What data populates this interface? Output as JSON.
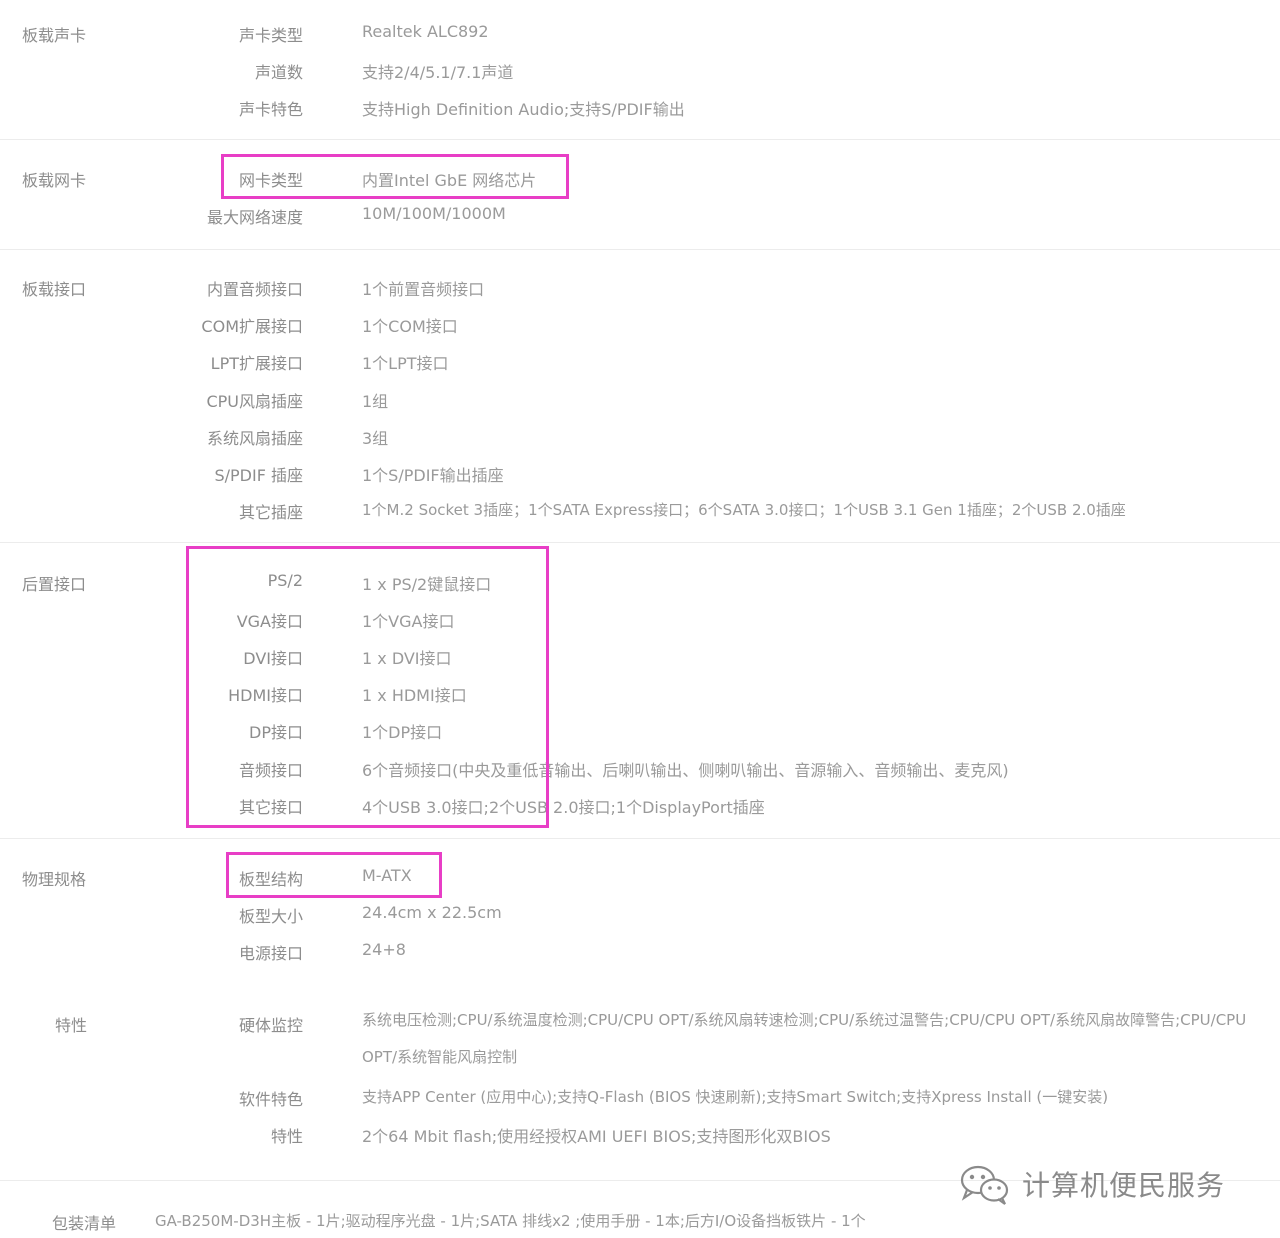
{
  "sections": {
    "audio": {
      "category": "板载声卡",
      "rows": [
        {
          "label": "声卡类型",
          "value": "Realtek ALC892"
        },
        {
          "label": "声道数",
          "value": "支持2/4/5.1/7.1声道"
        },
        {
          "label": "声卡特色",
          "value": "支持High Definition Audio;支持S/PDIF输出"
        }
      ]
    },
    "network": {
      "category": "板载网卡",
      "rows": [
        {
          "label": "网卡类型",
          "value": "内置Intel GbE 网络芯片"
        },
        {
          "label": "最大网络速度",
          "value": "10M/100M/1000M"
        }
      ]
    },
    "board_ports": {
      "category": "板载接口",
      "rows": [
        {
          "label": "内置音频接口",
          "value": "1个前置音频接口"
        },
        {
          "label": "COM扩展接口",
          "value": "1个COM接口"
        },
        {
          "label": "LPT扩展接口",
          "value": "1个LPT接口"
        },
        {
          "label": "CPU风扇插座",
          "value": "1组"
        },
        {
          "label": "系统风扇插座",
          "value": "3组"
        },
        {
          "label": "S/PDIF 插座",
          "value": "1个S/PDIF输出插座"
        },
        {
          "label": "其它插座",
          "value": "1个M.2 Socket 3插座；1个SATA Express接口；6个SATA 3.0接口；1个USB 3.1 Gen 1插座；2个USB 2.0插座"
        }
      ]
    },
    "rear_ports": {
      "category": "后置接口",
      "rows": [
        {
          "label": "PS/2",
          "value": "1 x PS/2键鼠接口"
        },
        {
          "label": "VGA接口",
          "value": "1个VGA接口"
        },
        {
          "label": "DVI接口",
          "value": "1 x DVI接口"
        },
        {
          "label": "HDMI接口",
          "value": "1 x HDMI接口"
        },
        {
          "label": "DP接口",
          "value": "1个DP接口"
        },
        {
          "label": "音频接口",
          "value": "6个音频接口(中央及重低音输出、后喇叭输出、侧喇叭输出、音源输入、音频输出、麦克风)"
        },
        {
          "label": "其它接口",
          "value": "4个USB 3.0接口;2个USB 2.0接口;1个DisplayPort插座"
        }
      ]
    },
    "physical": {
      "category": "物理规格",
      "rows": [
        {
          "label": "板型结构",
          "value": "M-ATX"
        },
        {
          "label": "板型大小",
          "value": "24.4cm x 22.5cm"
        },
        {
          "label": "电源接口",
          "value": "24+8"
        }
      ]
    },
    "features": {
      "category": "特性",
      "rows": [
        {
          "label": "硬体监控",
          "value": "系统电压检测;CPU/系统温度检测;CPU/CPU OPT/系统风扇转速检测;CPU/系统过温警告;CPU/CPU OPT/系统风扇故障警告;CPU/CPU OPT/系统智能风扇控制"
        },
        {
          "label": "软件特色",
          "value": "支持APP Center (应用中心);支持Q-Flash (BIOS 快速刷新);支持Smart Switch;支持Xpress Install (一键安装)"
        },
        {
          "label": "特性",
          "value": "2个64 Mbit flash;使用经授权AMI UEFI BIOS;支持图形化双BIOS"
        }
      ]
    },
    "package": {
      "category": "包装清单",
      "value": "GA-B250M-D3H主板 - 1片;驱动程序光盘 - 1片;SATA 排线x2 ;使用手册 - 1本;后方I/O设备挡板铁片 - 1个"
    }
  },
  "watermark": {
    "text": "计算机便民服务",
    "icon": "wechat-icon"
  },
  "colors": {
    "highlight": "#e83ec6",
    "text": "#9a9a9a",
    "separator": "#ececec"
  }
}
